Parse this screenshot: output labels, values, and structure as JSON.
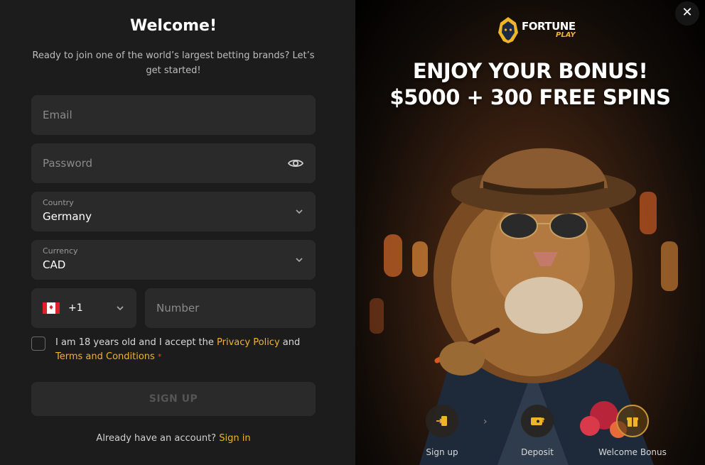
{
  "form": {
    "title": "Welcome!",
    "subtitle": "Ready to join one of the world’s largest betting brands? Let’s get started!",
    "email_placeholder": "Email",
    "password_placeholder": "Password",
    "country_label": "Country",
    "country_value": "Germany",
    "currency_label": "Currency",
    "currency_value": "CAD",
    "phone_code": "+1",
    "number_placeholder": "Number",
    "terms_prefix": "I am 18 years old and I accept the",
    "privacy_link": "Privacy Policy",
    "terms_and": "and",
    "terms_link": "Terms and Conditions",
    "required_mark": "*",
    "signup_label": "SIGN UP",
    "already_text": "Already have an account?",
    "signin_link": "Sign in"
  },
  "promo": {
    "close_glyph": "✕",
    "logo_line1": "FORTUNE",
    "logo_line2": "PLAY",
    "headline_line1": "ENJOY YOUR BONUS!",
    "headline_line2": "$5000 + 300 FREE SPINS",
    "steps": [
      {
        "label": "Sign up",
        "icon": "signup-icon"
      },
      {
        "label": "Deposit",
        "icon": "wallet-icon"
      },
      {
        "label": "Welcome Bonus",
        "icon": "gift-icon"
      }
    ]
  },
  "colors": {
    "accent": "#f0b429",
    "panel_bg": "#1c1c1c",
    "field_bg": "#2a2a2a"
  }
}
